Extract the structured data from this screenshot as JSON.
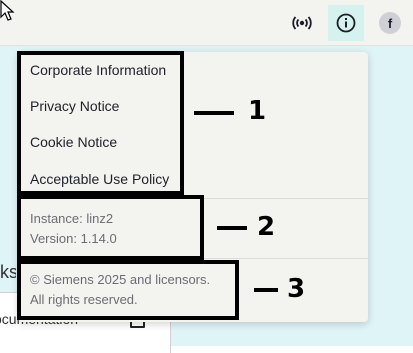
{
  "header": {
    "avatar_initial": "f",
    "icons": [
      "broadcast-icon",
      "info-icon"
    ]
  },
  "background": {
    "heading_fragment": "ks",
    "card_text_fragment": "ocumentation"
  },
  "menu": {
    "links": [
      "Corporate Information",
      "Privacy Notice",
      "Cookie Notice",
      "Acceptable Use Policy"
    ],
    "instance": "Instance: linz2",
    "version": "Version: 1.14.0",
    "copyright_line1": "© Siemens 2025 and licensors.",
    "copyright_line2": "All rights reserved."
  },
  "callouts": [
    "1",
    "2",
    "3"
  ]
}
